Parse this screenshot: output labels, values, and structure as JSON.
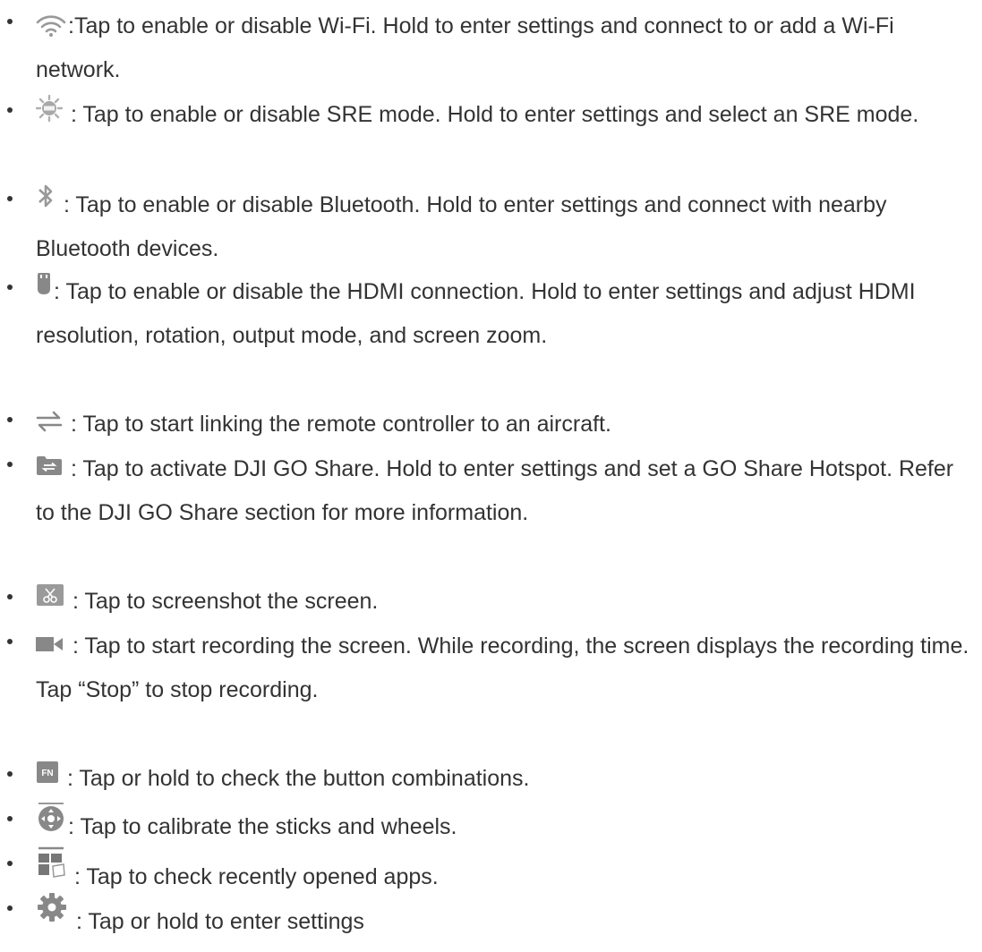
{
  "items": [
    {
      "icon": "wifi-icon",
      "text": ":Tap to enable or disable Wi-Fi. Hold to enter settings and connect to or add a Wi-Fi network."
    },
    {
      "icon": "sre-icon",
      "text": " : Tap to enable or disable SRE mode. Hold to enter settings and select an SRE mode."
    },
    {
      "icon": "bluetooth-icon",
      "text": " : Tap to enable or disable Bluetooth. Hold to enter settings and connect with nearby Bluetooth devices."
    },
    {
      "icon": "hdmi-icon",
      "text": ": Tap to enable or disable the HDMI connection. Hold to enter settings and adjust HDMI resolution, rotation, output mode, and screen zoom."
    },
    {
      "icon": "link-arrows-icon",
      "text": " : Tap to start linking the remote controller to an aircraft."
    },
    {
      "icon": "go-share-icon",
      "text": " : Tap to activate DJI GO Share. Hold to enter settings and set a GO Share Hotspot. Refer to the DJI GO Share section for more information."
    },
    {
      "icon": "screenshot-icon",
      "text": " : Tap to screenshot the screen."
    },
    {
      "icon": "screen-record-icon",
      "text": "  : Tap to start recording the screen. While recording, the screen displays the recording time. Tap “Stop” to stop recording."
    },
    {
      "icon": "fn-icon",
      "text": " : Tap or hold to check the button combinations."
    },
    {
      "icon": "calibrate-icon",
      "text": ": Tap to calibrate the sticks and wheels."
    },
    {
      "icon": "recent-apps-icon",
      "text": " : Tap to check recently opened apps."
    },
    {
      "icon": "gear-icon",
      "text": " : Tap or hold to enter settings"
    }
  ],
  "icon_color": "#999999",
  "icon_color_dark": "#777777",
  "text_color": "#333333"
}
